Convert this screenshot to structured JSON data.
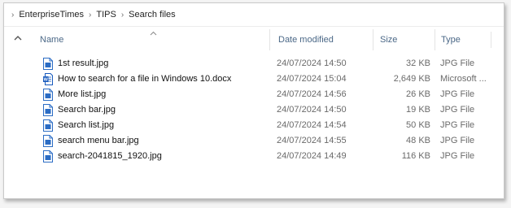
{
  "breadcrumb": [
    "EnterpriseTimes",
    "TIPS",
    "Search files"
  ],
  "columns": {
    "name": "Name",
    "date": "Date modified",
    "size": "Size",
    "type": "Type"
  },
  "files": [
    {
      "name": "1st result.jpg",
      "date": "24/07/2024 14:50",
      "size": "32 KB",
      "type": "JPG File",
      "icon": "jpg-file-icon"
    },
    {
      "name": "How to search for a file in Windows 10.docx",
      "date": "24/07/2024 15:04",
      "size": "2,649 KB",
      "type": "Microsoft ...",
      "icon": "word-document-icon"
    },
    {
      "name": "More list.jpg",
      "date": "24/07/2024 14:56",
      "size": "26 KB",
      "type": "JPG File",
      "icon": "jpg-file-icon"
    },
    {
      "name": "Search bar.jpg",
      "date": "24/07/2024 14:50",
      "size": "19 KB",
      "type": "JPG File",
      "icon": "jpg-file-icon"
    },
    {
      "name": "Search list.jpg",
      "date": "24/07/2024 14:54",
      "size": "50 KB",
      "type": "JPG File",
      "icon": "jpg-file-icon"
    },
    {
      "name": "search menu bar.jpg",
      "date": "24/07/2024 14:55",
      "size": "48 KB",
      "type": "JPG File",
      "icon": "jpg-file-icon"
    },
    {
      "name": "search-2041815_1920.jpg",
      "date": "24/07/2024 14:49",
      "size": "116 KB",
      "type": "JPG File",
      "icon": "jpg-file-icon"
    }
  ],
  "colors": {
    "header_text": "#4b6887",
    "icon_blue": "#2b6cc4",
    "word_blue": "#185abd"
  }
}
